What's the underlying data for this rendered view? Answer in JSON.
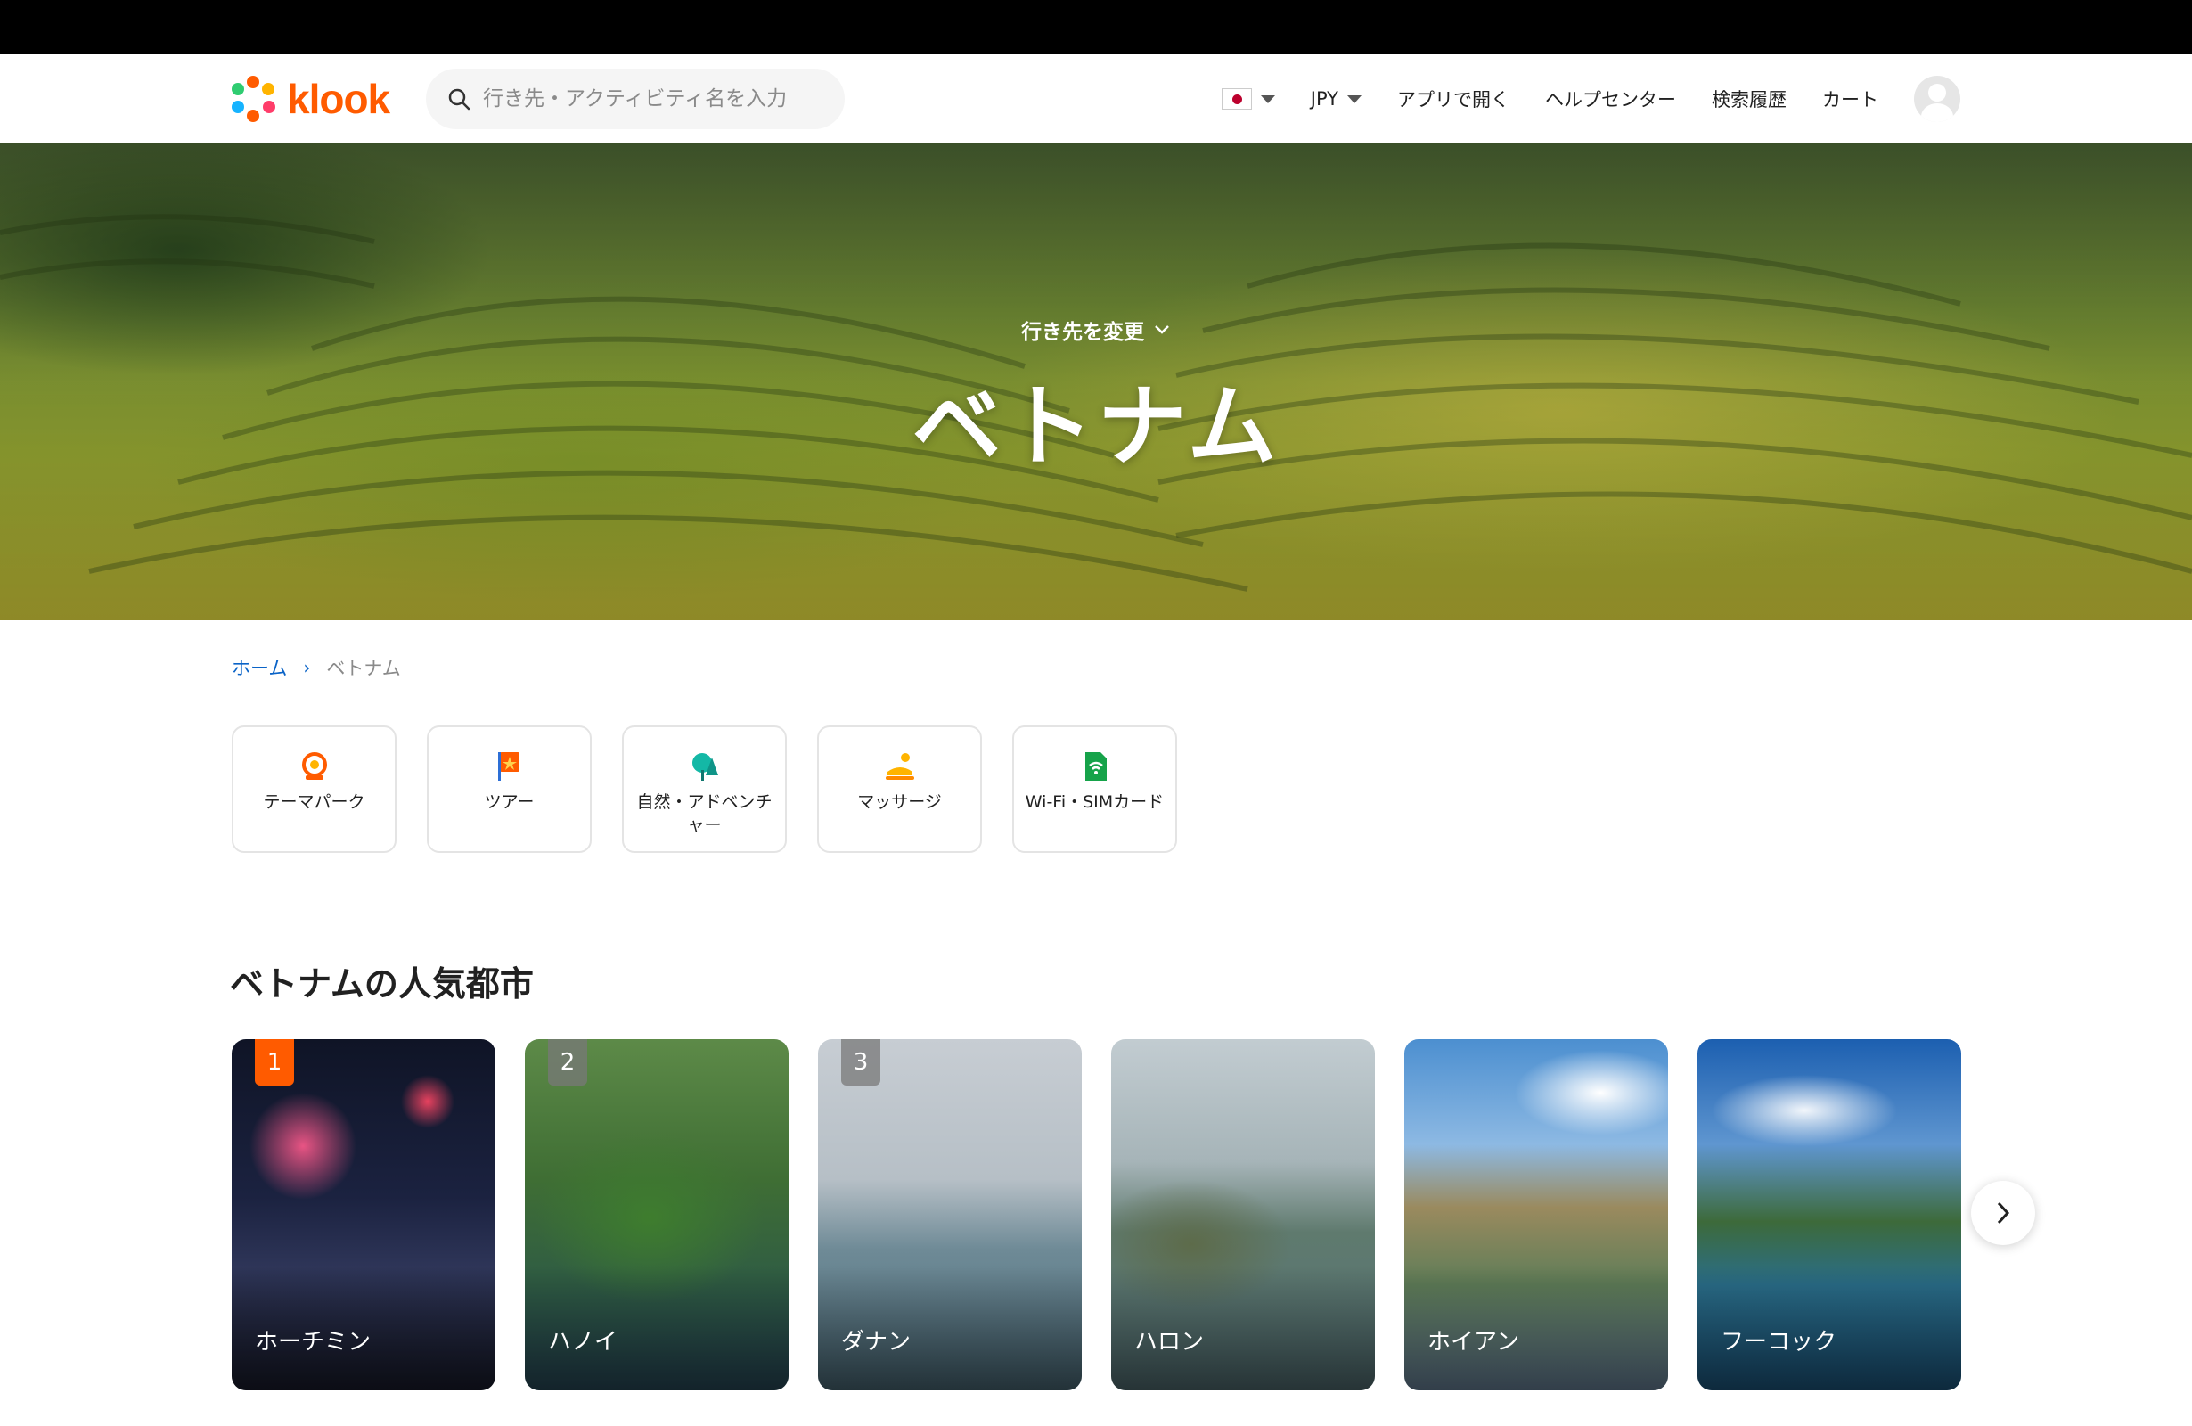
{
  "header": {
    "logo_text": "klook",
    "search_placeholder": "行き先・アクティビティ名を入力",
    "currency": "JPY",
    "nav": {
      "app": "アプリで開く",
      "help": "ヘルプセンター",
      "history": "検索履歴",
      "cart": "カート"
    }
  },
  "hero": {
    "change_destination": "行き先を変更",
    "title": "ベトナム"
  },
  "breadcrumb": {
    "home": "ホーム",
    "current": "ベトナム"
  },
  "categories": [
    {
      "label": "テーマパーク",
      "icon": "ferris-wheel-icon"
    },
    {
      "label": "ツアー",
      "icon": "flag-icon"
    },
    {
      "label": "自然・アドベンチャー",
      "icon": "nature-icon"
    },
    {
      "label": "マッサージ",
      "icon": "massage-icon"
    },
    {
      "label": "Wi-Fi・SIMカード",
      "icon": "wifi-sim-icon"
    }
  ],
  "popular_cities": {
    "title": "ベトナムの人気都市",
    "items": [
      {
        "rank": "1",
        "name": "ホーチミン"
      },
      {
        "rank": "2",
        "name": "ハノイ"
      },
      {
        "rank": "3",
        "name": "ダナン"
      },
      {
        "rank": "",
        "name": "ハロン"
      },
      {
        "rank": "",
        "name": "ホイアン"
      },
      {
        "rank": "",
        "name": "フーコック"
      }
    ]
  },
  "colors": {
    "brand": "#ff5b00",
    "link": "#0a63c7"
  }
}
